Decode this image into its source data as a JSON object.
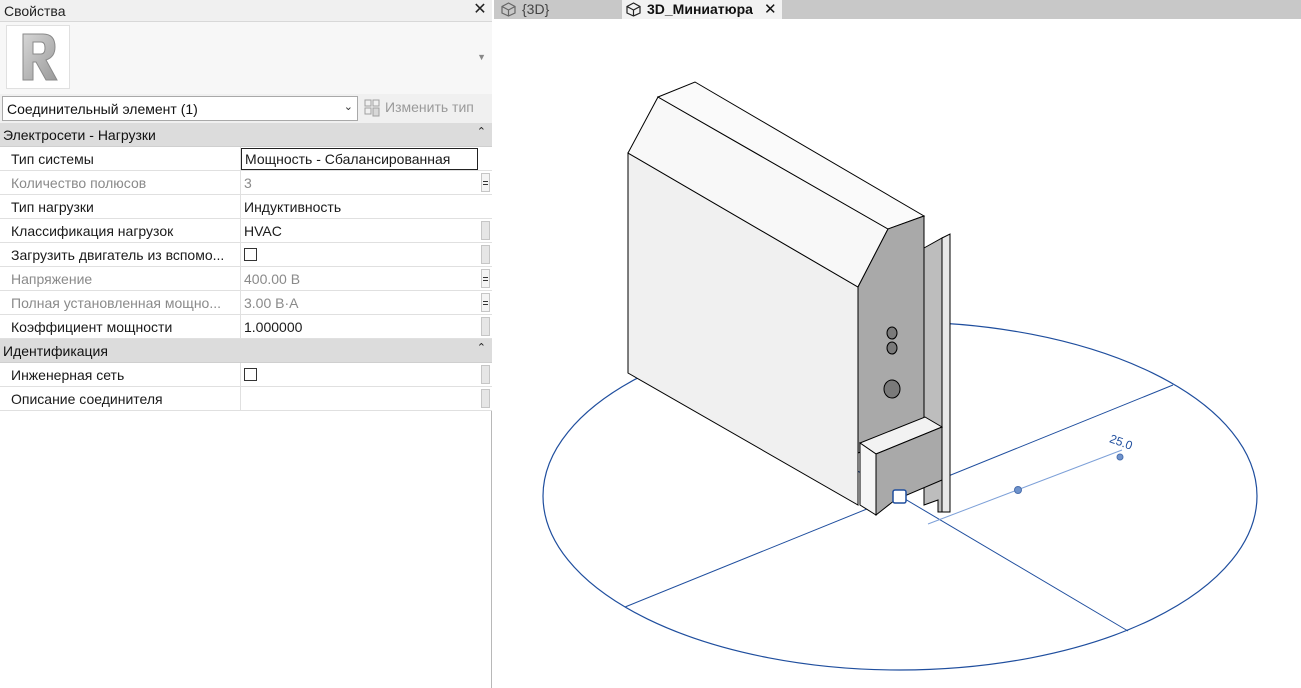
{
  "properties": {
    "title": "Свойства",
    "close_glyph": "✕",
    "logo_icon": "revit-logo-icon",
    "type_selector": "Соединительный элемент (1)",
    "edit_type": "Изменить тип",
    "groups": [
      {
        "title": "Электросети - Нагрузки",
        "rows": [
          {
            "name": "Тип системы",
            "value": "Мощность - Сбалансированная"
          },
          {
            "name": "Количество полюсов",
            "value": "3"
          },
          {
            "name": "Тип нагрузки",
            "value": "Индуктивность"
          },
          {
            "name": "Классификация нагрузок",
            "value": "HVAC"
          },
          {
            "name": "Загрузить двигатель из вспомо...",
            "value": ""
          },
          {
            "name": "Напряжение",
            "value": "400.00 В"
          },
          {
            "name": "Полная установленная мощно...",
            "value": "3.00 В·А"
          },
          {
            "name": "Коэффициент мощности",
            "value": "1.000000"
          }
        ]
      },
      {
        "title": "Идентификация",
        "rows": [
          {
            "name": "Инженерная сеть",
            "value": ""
          },
          {
            "name": "Описание соединителя",
            "value": ""
          }
        ]
      }
    ]
  },
  "tabs": [
    {
      "label": "{3D}",
      "icon": "3d-view-icon",
      "active": false
    },
    {
      "label": "3D_Миниатюра",
      "icon": "3d-view-icon",
      "active": true,
      "close": "✕"
    }
  ],
  "viewport": {
    "dimension_label": "25.0",
    "line_color": "#1f4e9e",
    "model_face_color": "#f0f0f0",
    "model_side_color": "#a9a9a9"
  }
}
